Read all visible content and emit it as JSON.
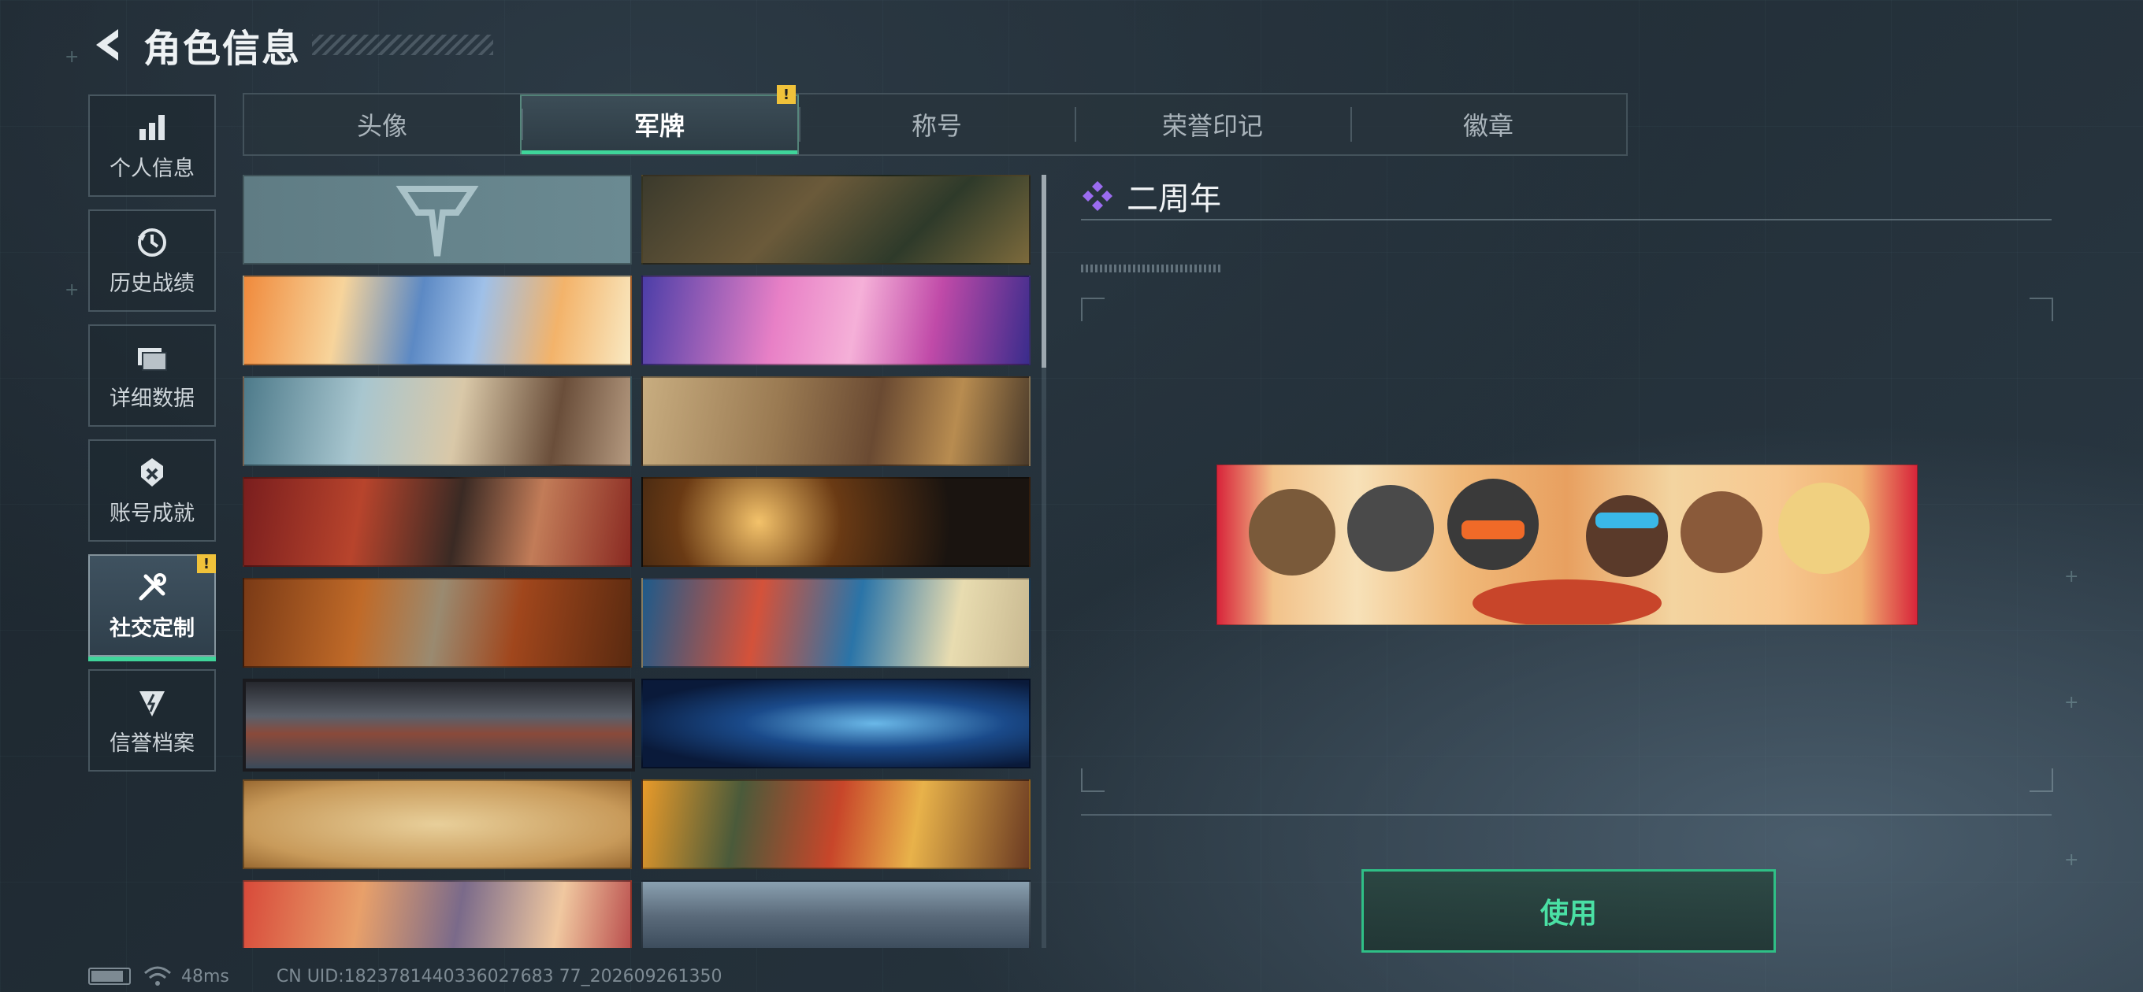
{
  "header": {
    "title": "角色信息"
  },
  "sidebar": {
    "items": [
      {
        "label": "个人信息",
        "icon": "bar-chart-icon",
        "active": false
      },
      {
        "label": "历史战绩",
        "icon": "history-icon",
        "active": false
      },
      {
        "label": "详细数据",
        "icon": "folder-icon",
        "active": false
      },
      {
        "label": "账号成就",
        "icon": "achievement-icon",
        "active": false
      },
      {
        "label": "社交定制",
        "icon": "tools-icon",
        "active": true,
        "badge": "!"
      },
      {
        "label": "信誉档案",
        "icon": "credit-icon",
        "active": false
      }
    ]
  },
  "tabs": {
    "items": [
      {
        "label": "头像",
        "active": false
      },
      {
        "label": "军牌",
        "active": true,
        "badge": "!"
      },
      {
        "label": "称号",
        "active": false
      },
      {
        "label": "荣誉印记",
        "active": false
      },
      {
        "label": "徽章",
        "active": false
      }
    ]
  },
  "plates": {
    "rows": [
      [
        "logo-plate",
        "weapons-table"
      ],
      [
        "blue-operator-orange-leaves",
        "pink-retro-train"
      ],
      [
        "mechanic-girl",
        "desert-town"
      ],
      [
        "red-squad-soldiers",
        "candle-swan"
      ],
      [
        "autumn-skeleton-hand",
        "octopus-wave"
      ],
      [
        "pixel-room",
        "xray-skeleton"
      ],
      [
        "da-vinci-sketch",
        "feast-table"
      ],
      [
        "party-group",
        "city-harbor"
      ]
    ]
  },
  "detail": {
    "name": "二周年",
    "use_button": "使用"
  },
  "status_bar": {
    "ping": "48ms",
    "uid": "CN UID:1823781440336027683 77_202609261350"
  },
  "colors": {
    "accent": "#3fd59a",
    "badge": "#f0c23a",
    "diamond": "#9b6cf0"
  }
}
